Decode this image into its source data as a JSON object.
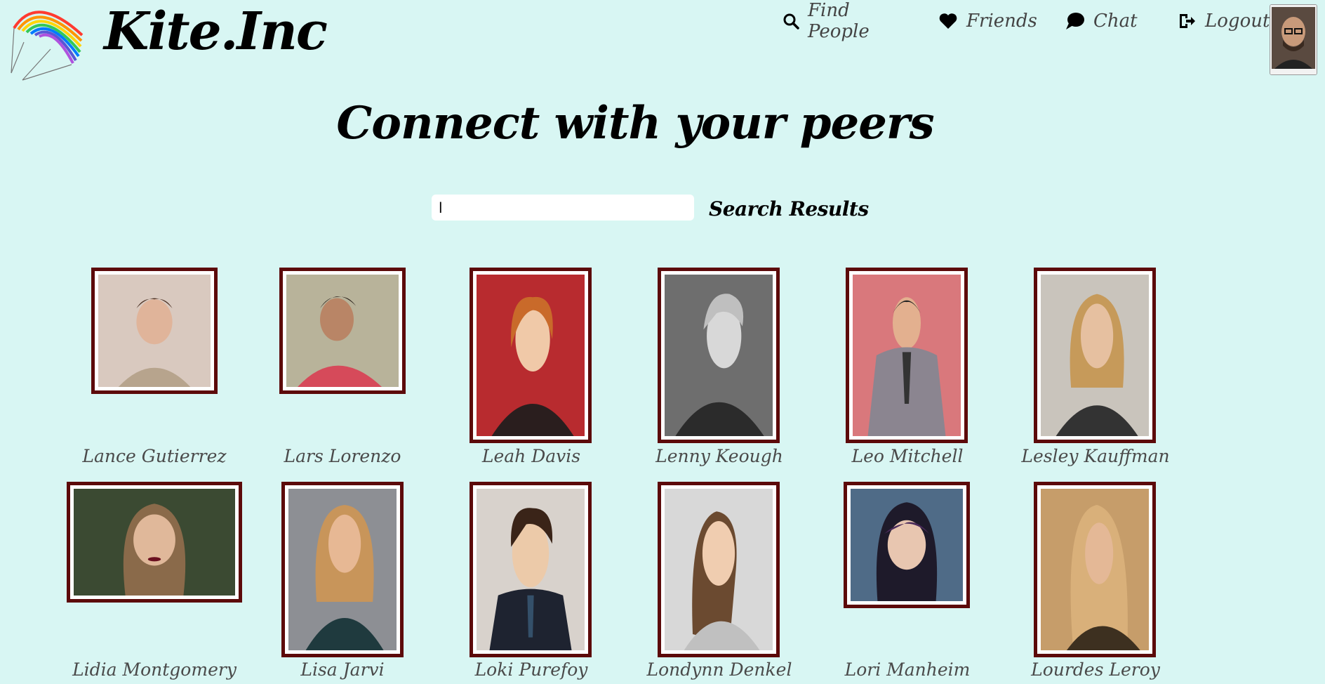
{
  "brand": {
    "name": "Kite.Inc"
  },
  "nav": [
    {
      "label": "Find People",
      "icon": "search-icon"
    },
    {
      "label": "Friends",
      "icon": "heart-icon"
    },
    {
      "label": "Chat",
      "icon": "chat-bubble-icon"
    },
    {
      "label": "Logout",
      "icon": "logout-icon"
    }
  ],
  "page": {
    "title": "Connect with your peers"
  },
  "search": {
    "value": "l",
    "placeholder": "",
    "results_label": "Search Results"
  },
  "people": [
    {
      "name": "Lance Gutierrez",
      "photo_bg": "#d9c9bf"
    },
    {
      "name": "Lars Lorenzo",
      "photo_bg": "#b8b39a"
    },
    {
      "name": "Leah Davis",
      "photo_bg": "#b82b2f"
    },
    {
      "name": "Lenny Keough",
      "photo_bg": "#6e6e6e"
    },
    {
      "name": "Leo Mitchell",
      "photo_bg": "#d9787c"
    },
    {
      "name": "Lesley Kauffman",
      "photo_bg": "#c9c4bc"
    },
    {
      "name": "Lidia Montgomery",
      "photo_bg": "#3b4a32"
    },
    {
      "name": "Lisa Jarvi",
      "photo_bg": "#8d8f94"
    },
    {
      "name": "Loki Purefoy",
      "photo_bg": "#d8d2cc"
    },
    {
      "name": "Londynn Denkel",
      "photo_bg": "#d8d8d8"
    },
    {
      "name": "Lori Manheim",
      "photo_bg": "#4f6b87"
    },
    {
      "name": "Lourdes Leroy",
      "photo_bg": "#c69d6a"
    }
  ],
  "colors": {
    "background": "#d8f6f3",
    "frame": "#5c0a0a",
    "name_text": "#4a4a4a"
  }
}
